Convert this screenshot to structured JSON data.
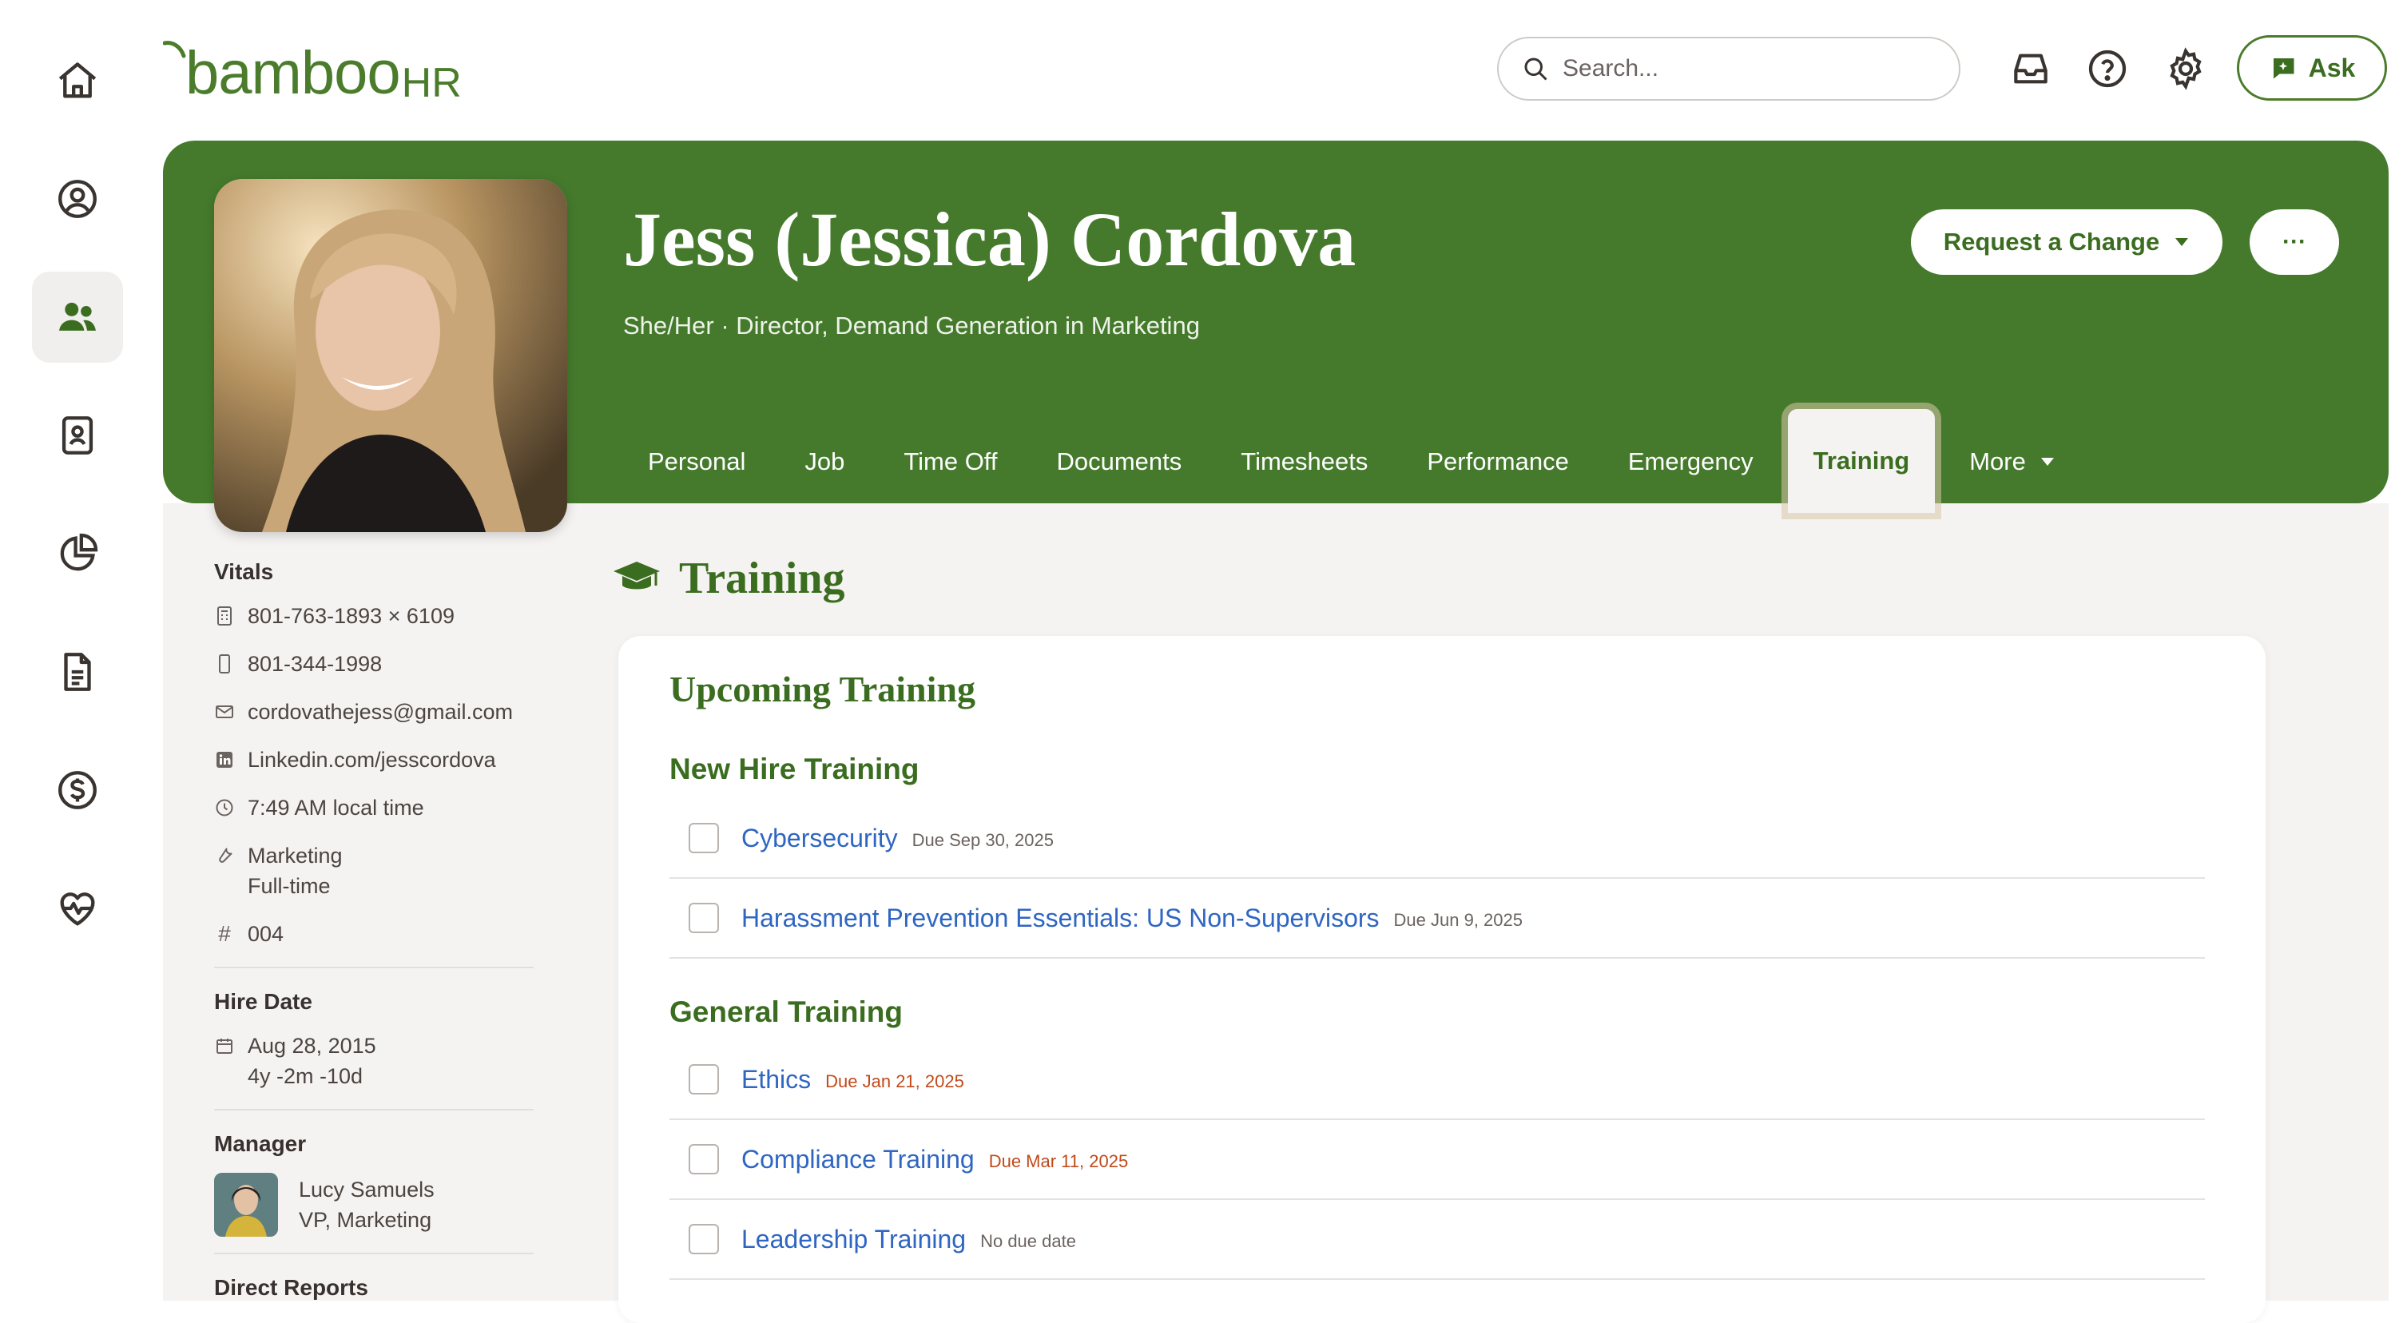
{
  "app": {
    "logo_text": "bamboo",
    "logo_suffix": "HR"
  },
  "top_bar": {
    "search_placeholder": "Search...",
    "ask_label": "Ask"
  },
  "rail": {
    "items": [
      {
        "icon": "home-icon"
      },
      {
        "icon": "user-circle-icon"
      },
      {
        "icon": "people-icon",
        "active": true
      },
      {
        "icon": "id-badge-icon"
      },
      {
        "icon": "pie-chart-icon"
      },
      {
        "icon": "document-icon"
      },
      {
        "icon": "dollar-circle-icon"
      },
      {
        "icon": "heart-pulse-icon"
      }
    ]
  },
  "profile": {
    "name": "Jess (Jessica) Cordova",
    "subtitle": "She/Her · Director, Demand Generation in Marketing",
    "request_change_label": "Request a Change",
    "more_actions_label": "···"
  },
  "tabs": [
    "Personal",
    "Job",
    "Time Off",
    "Documents",
    "Timesheets",
    "Performance",
    "Emergency",
    "Training",
    "More"
  ],
  "active_tab": "Training",
  "vitals": {
    "heading": "Vitals",
    "work_phone": "801-763-1893 × 6109",
    "mobile_phone": "801-344-1998",
    "email": "cordovathejess@gmail.com",
    "linkedin": "Linkedin.com/jesscordova",
    "local_time": "7:49 AM local time",
    "department": "Marketing",
    "employment_type": "Full-time",
    "employee_number": "004"
  },
  "hire_date": {
    "heading": "Hire Date",
    "date": "Aug 28, 2015",
    "tenure": "4y -2m -10d"
  },
  "manager": {
    "heading": "Manager",
    "name": "Lucy Samuels",
    "title": "VP, Marketing"
  },
  "direct_reports_heading": "Direct Reports",
  "training": {
    "title": "Training",
    "upcoming_heading": "Upcoming Training",
    "groups": [
      {
        "name": "New Hire Training",
        "items": [
          {
            "title": "Cybersecurity",
            "due": "Due Sep 30, 2025",
            "overdue": false
          },
          {
            "title": "Harassment Prevention Essentials: US Non-Supervisors",
            "due": "Due Jun 9, 2025",
            "overdue": false
          }
        ]
      },
      {
        "name": "General Training",
        "items": [
          {
            "title": "Ethics",
            "due": "Due Jan 21, 2025",
            "overdue": true
          },
          {
            "title": "Compliance Training",
            "due": "Due Mar 11, 2025",
            "overdue": true
          },
          {
            "title": "Leadership Training",
            "due": "No due date",
            "overdue": false
          }
        ]
      }
    ]
  },
  "colors": {
    "brand_green": "#457a2c",
    "link_blue": "#2f66c2",
    "overdue_orange": "#c14a1a"
  }
}
